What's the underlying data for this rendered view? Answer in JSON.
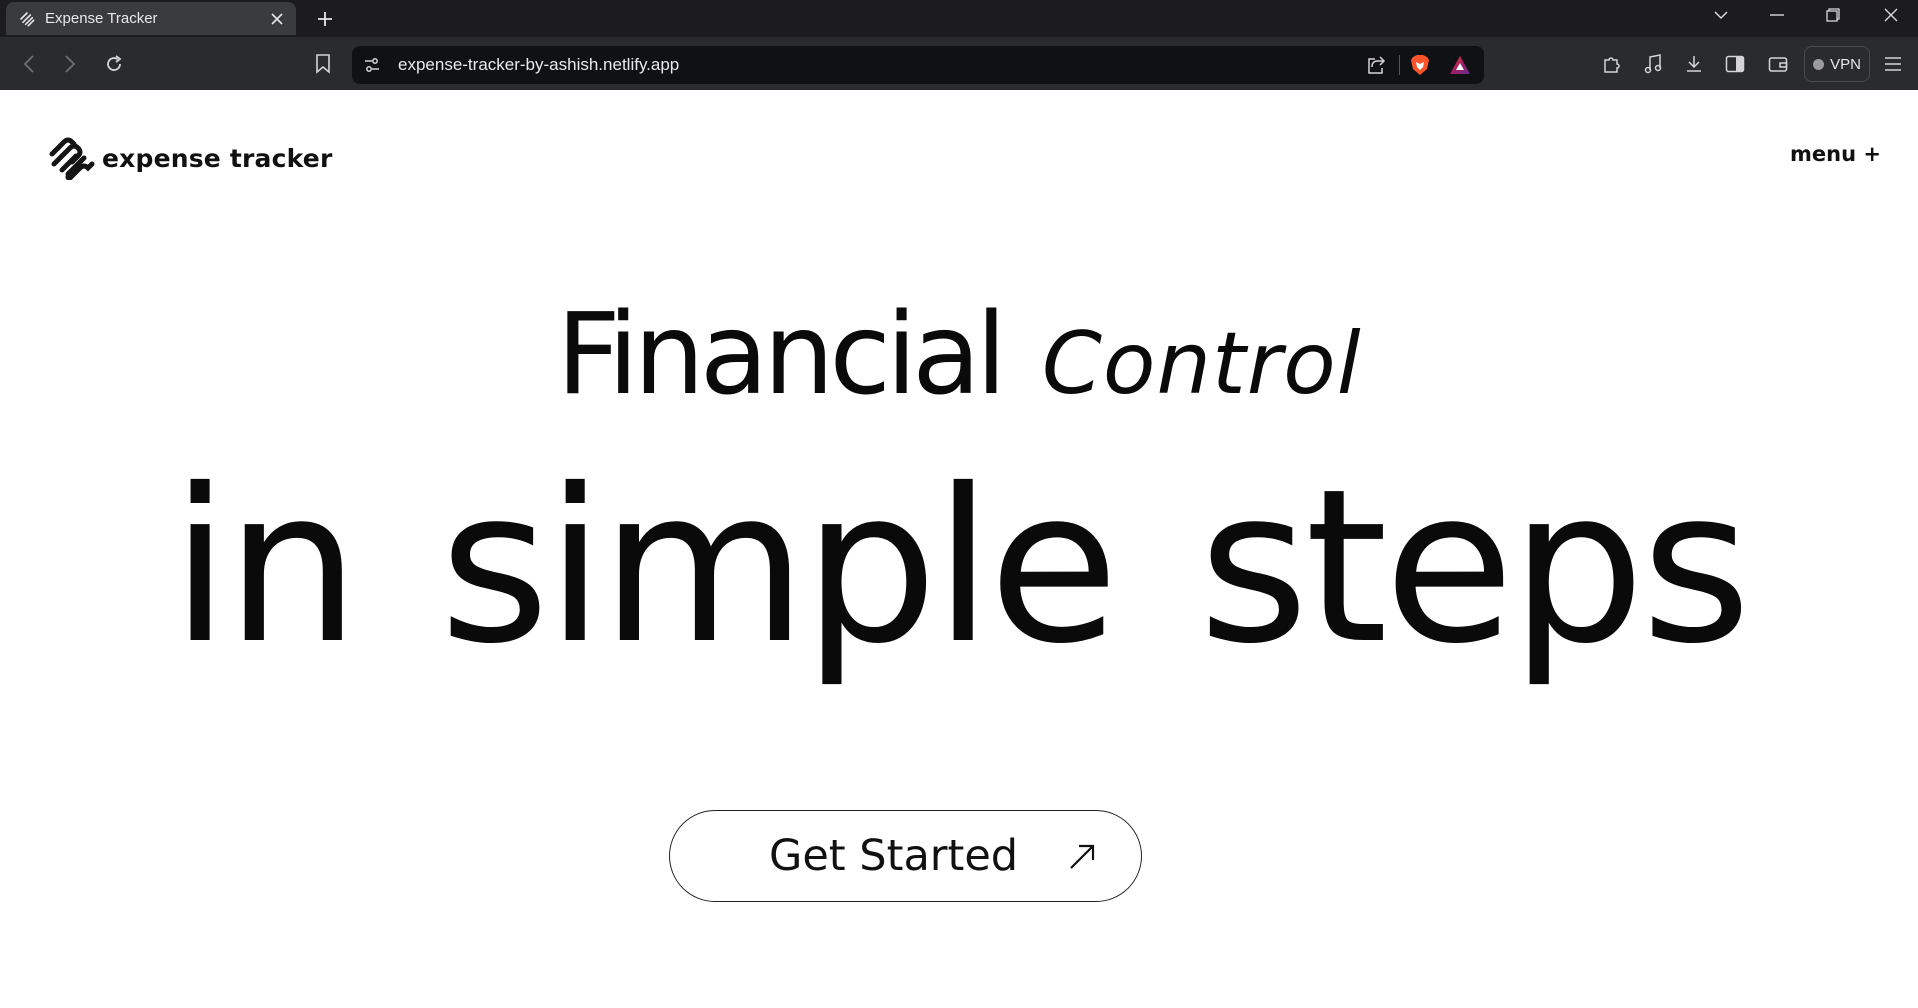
{
  "browser": {
    "tab_title": "Expense Tracker",
    "url": "expense-tracker-by-ashish.netlify.app",
    "vpn_label": "VPN"
  },
  "site": {
    "logo_text": "expense tracker",
    "menu_label": "menu +"
  },
  "hero": {
    "line1_word": "Financial",
    "line1_italic": "Control",
    "line2": "in simple steps",
    "cta_label": "Get Started"
  }
}
